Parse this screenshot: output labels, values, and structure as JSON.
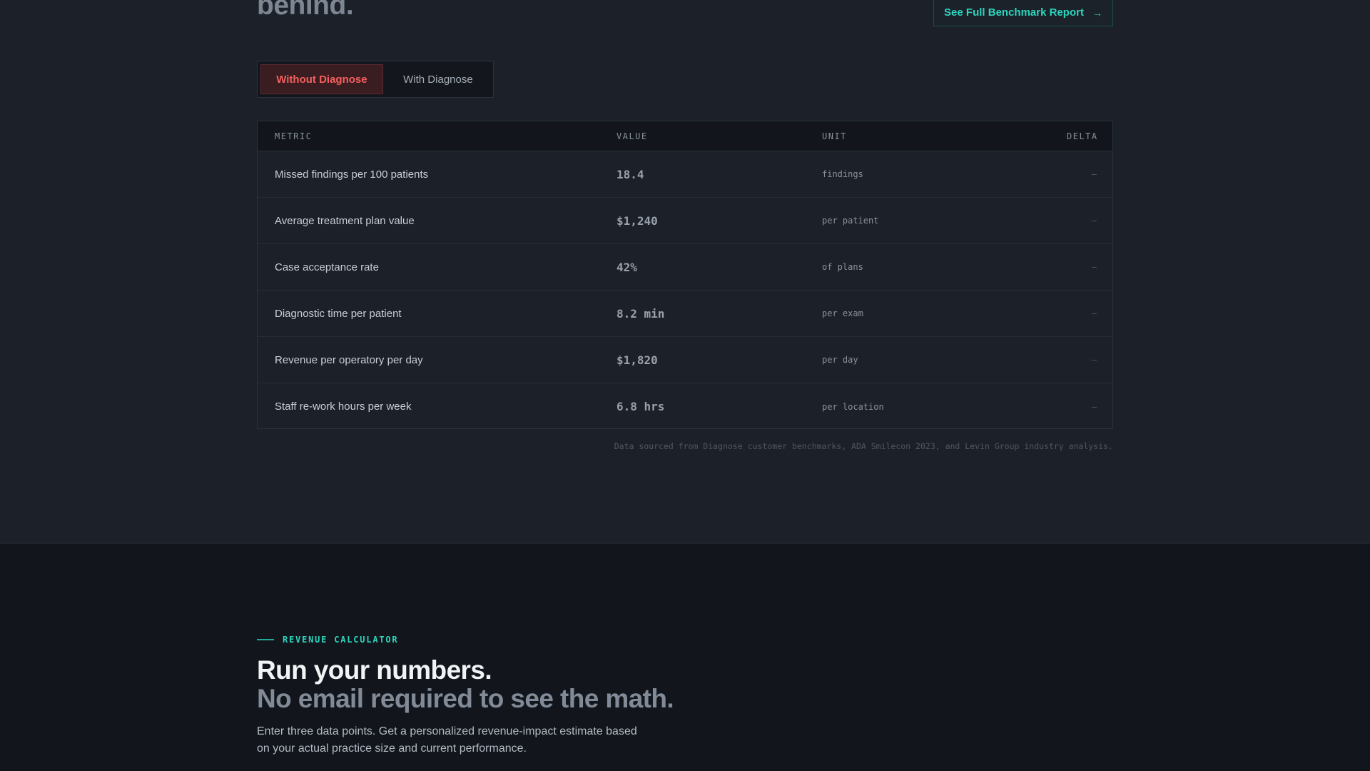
{
  "hero": {
    "heading_tail": "behind."
  },
  "report_button": {
    "label": "See Full Benchmark Report",
    "icon": "arrow-right-icon"
  },
  "toggle": {
    "options": [
      {
        "label": "Without Diagnose",
        "active": true
      },
      {
        "label": "With Diagnose",
        "active": false
      }
    ]
  },
  "table": {
    "headers": {
      "metric": "METRIC",
      "value": "VALUE",
      "unit": "UNIT",
      "delta": "DELTA"
    },
    "rows": [
      {
        "metric": "Missed findings per 100 patients",
        "value": "18.4",
        "unit": "findings",
        "delta": "—"
      },
      {
        "metric": "Average treatment plan value",
        "value": "$1,240",
        "unit": "per patient",
        "delta": "—"
      },
      {
        "metric": "Case acceptance rate",
        "value": "42%",
        "unit": "of plans",
        "delta": "—"
      },
      {
        "metric": "Diagnostic time per patient",
        "value": "8.2 min",
        "unit": "per exam",
        "delta": "—"
      },
      {
        "metric": "Revenue per operatory per day",
        "value": "$1,820",
        "unit": "per day",
        "delta": "—"
      },
      {
        "metric": "Staff re-work hours per week",
        "value": "6.8 hrs",
        "unit": "per location",
        "delta": "—"
      }
    ]
  },
  "source_note": "Data sourced from Diagnose customer benchmarks, ADA Smilecon 2023, and Levin Group industry analysis.",
  "calculator": {
    "eyebrow": "REVENUE CALCULATOR",
    "title": "Run your numbers.",
    "subtitle": "No email required to see the math.",
    "lead": "Enter three data points. Get a personalized revenue-impact estimate based on your actual practice size and current performance."
  },
  "colors": {
    "accent_teal": "#2dd4bf",
    "alert_red": "#f4605f",
    "page_bg": "#1c2129",
    "section_dark_bg": "#12161c"
  }
}
